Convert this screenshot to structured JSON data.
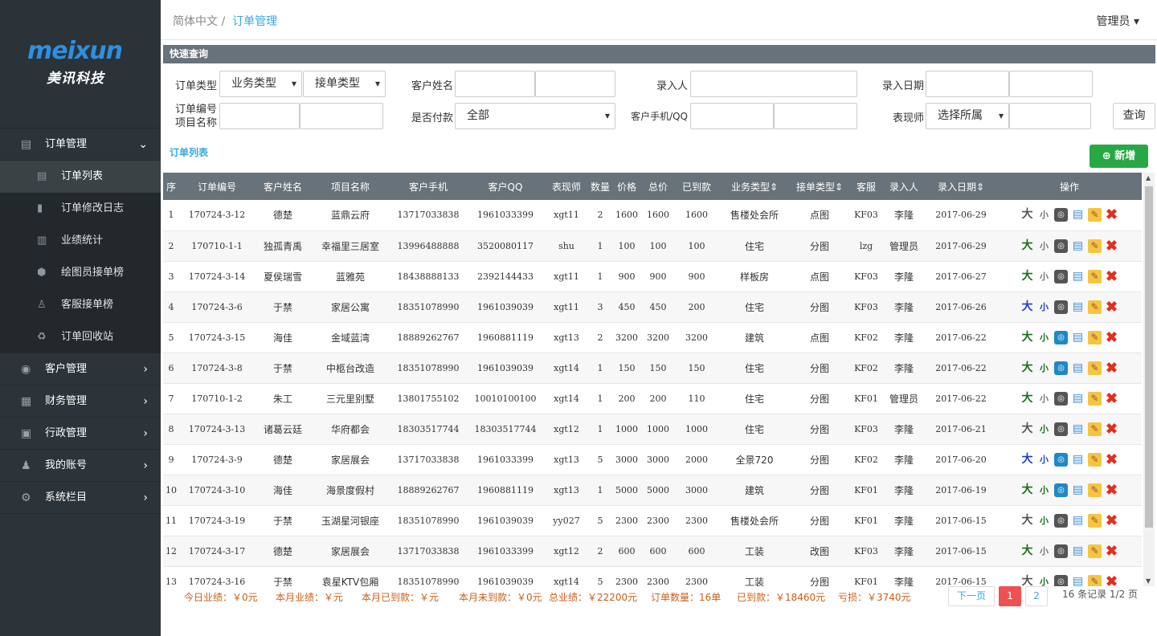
{
  "logo": {
    "word": "meixun",
    "cn": "美讯科技"
  },
  "menu": [
    {
      "label": "订单管理",
      "icon": "▤",
      "arrow": "⌄",
      "open": true,
      "children": [
        {
          "label": "订单列表",
          "icon": "▤",
          "active": true
        },
        {
          "label": "订单修改日志",
          "icon": "▮"
        },
        {
          "label": "业绩统计",
          "icon": "▥"
        },
        {
          "label": "绘图员接单榜",
          "icon": "⬢"
        },
        {
          "label": "客服接单榜",
          "icon": "♙"
        },
        {
          "label": "订单回收站",
          "icon": "♻"
        }
      ]
    },
    {
      "label": "客户管理",
      "icon": "◉",
      "arrow": "›"
    },
    {
      "label": "财务管理",
      "icon": "▦",
      "arrow": "›"
    },
    {
      "label": "行政管理",
      "icon": "▣",
      "arrow": "›"
    },
    {
      "label": "我的账号",
      "icon": "♟",
      "arrow": "›"
    },
    {
      "label": "系统栏目",
      "icon": "⚙",
      "arrow": "›"
    }
  ],
  "breadcrumb": {
    "root": "简体中文",
    "sep": "/",
    "current": "订单管理"
  },
  "user": {
    "name": "管理员",
    "caret": "▾"
  },
  "quick": {
    "title": "快速查询",
    "order_type": "订单类型",
    "biz_type": "业务类型",
    "take_type": "接单类型",
    "cust_name": "客户姓名",
    "entered_by": "录入人",
    "entry_date": "录入日期",
    "order_no": "订单编号",
    "project_name": "项目名称",
    "paid": "是否付款",
    "paid_value": "全部",
    "phone": "客户手机/QQ",
    "artist": "表现师",
    "artist_value": "选择所属",
    "query": "查询"
  },
  "list": {
    "title": "订单列表",
    "add": "新增",
    "add_icon": "⊕"
  },
  "table": {
    "headers": [
      "序",
      "订单编号",
      "客户姓名",
      "项目名称",
      "客户手机",
      "客户QQ",
      "表现师",
      "数量",
      "价格",
      "总价",
      "已到款",
      "业务类型⇕",
      "接单类型⇕",
      "客服",
      "录入人",
      "录入日期⇕",
      "操作"
    ],
    "rows": [
      [
        "1",
        "170724-3-12",
        "德楚",
        "蓝鼎云府",
        "13717033838",
        "1961033399",
        "xgt11",
        "2",
        "1600",
        "1600",
        "1600",
        "售楼处会所",
        "点图",
        "KF03",
        "李隆",
        "2017-06-29"
      ],
      [
        "2",
        "170710-1-1",
        "独孤青禹",
        "幸福里三居室",
        "13996488888",
        "3520080117",
        "shu",
        "1",
        "100",
        "100",
        "100",
        "住宅",
        "分图",
        "lzg",
        "管理员",
        "2017-06-29"
      ],
      [
        "3",
        "170724-3-14",
        "夏侯瑞雪",
        "蓝雅苑",
        "18438888133",
        "2392144433",
        "xgt11",
        "1",
        "900",
        "900",
        "900",
        "样板房",
        "点图",
        "KF03",
        "李隆",
        "2017-06-27"
      ],
      [
        "4",
        "170724-3-6",
        "于禁",
        "家居公寓",
        "18351078990",
        "1961039039",
        "xgt11",
        "3",
        "450",
        "450",
        "200",
        "住宅",
        "分图",
        "KF03",
        "李隆",
        "2017-06-26"
      ],
      [
        "5",
        "170724-3-15",
        "海佳",
        "金域蓝湾",
        "18889262767",
        "1960881119",
        "xgt13",
        "2",
        "3200",
        "3200",
        "3200",
        "建筑",
        "点图",
        "KF02",
        "李隆",
        "2017-06-22"
      ],
      [
        "6",
        "170724-3-8",
        "于禁",
        "中柩台改造",
        "18351078990",
        "1961039039",
        "xgt14",
        "1",
        "150",
        "150",
        "150",
        "住宅",
        "分图",
        "KF02",
        "李隆",
        "2017-06-22"
      ],
      [
        "7",
        "170710-1-2",
        "朱工",
        "三元里别墅",
        "13801755102",
        "10010100100",
        "xgt14",
        "1",
        "200",
        "200",
        "110",
        "住宅",
        "分图",
        "KF01",
        "管理员",
        "2017-06-22"
      ],
      [
        "8",
        "170724-3-13",
        "诸葛云廷",
        "华府都会",
        "18303517744",
        "18303517744",
        "xgt12",
        "1",
        "1000",
        "1000",
        "1000",
        "住宅",
        "分图",
        "KF03",
        "李隆",
        "2017-06-21"
      ],
      [
        "9",
        "170724-3-9",
        "德楚",
        "家居展会",
        "13717033838",
        "1961033399",
        "xgt13",
        "5",
        "3000",
        "3000",
        "2000",
        "全景720",
        "分图",
        "KF02",
        "李隆",
        "2017-06-20"
      ],
      [
        "10",
        "170724-3-10",
        "海佳",
        "海景度假村",
        "18889262767",
        "1960881119",
        "xgt13",
        "1",
        "5000",
        "5000",
        "3000",
        "建筑",
        "分图",
        "KF01",
        "李隆",
        "2017-06-19"
      ],
      [
        "11",
        "170724-3-19",
        "于禁",
        "玉湖星河银座",
        "18351078990",
        "1961039039",
        "yy027",
        "5",
        "2300",
        "2300",
        "2300",
        "售楼处会所",
        "分图",
        "KF01",
        "李隆",
        "2017-06-15"
      ],
      [
        "12",
        "170724-3-17",
        "德楚",
        "家居展会",
        "13717033838",
        "1961033399",
        "xgt12",
        "2",
        "600",
        "600",
        "600",
        "工装",
        "改图",
        "KF03",
        "李隆",
        "2017-06-15"
      ],
      [
        "13",
        "170724-3-16",
        "于禁",
        "袁星KTV包厢",
        "18351078990",
        "1961039039",
        "xgt14",
        "5",
        "2300",
        "2300",
        "2300",
        "工装",
        "分图",
        "KF01",
        "李隆",
        "2017-06-15"
      ]
    ],
    "op_states": [
      [
        "#555",
        "#777",
        false
      ],
      [
        "#1a6e1a",
        "#777",
        false
      ],
      [
        "#1a6e1a",
        "#777",
        false
      ],
      [
        "#1e3fd0",
        "#1e3fd0",
        false
      ],
      [
        "#1a6e1a",
        "#1a6e1a",
        true
      ],
      [
        "#1a6e1a",
        "#1a6e1a",
        true
      ],
      [
        "#1a6e1a",
        "#777",
        false
      ],
      [
        "#555",
        "#1a6e1a",
        false
      ],
      [
        "#1e3fd0",
        "#1e3fd0",
        true
      ],
      [
        "#1a6e1a",
        "#1a6e1a",
        true
      ],
      [
        "#555",
        "#1a6e1a",
        false
      ],
      [
        "#1a6e1a",
        "#777",
        false
      ],
      [
        "#555",
        "#1a6e1a",
        false
      ]
    ]
  },
  "icons": {
    "op1": "大",
    "op2": "小",
    "op3": "◎",
    "op4": "▤",
    "op5": "✎",
    "op6": "✖"
  },
  "footer": {
    "today": "今日业绩：￥0元",
    "month": "本月业绩：￥元",
    "month_paid": "本月已到款：￥元",
    "month_unpaid": "本月未到款：￥0元",
    "total": "总业绩：￥22200元",
    "count": "订单数量：16单",
    "paid": "已到款：￥18460元",
    "loss": "亏损：￥3740元"
  },
  "pagination": {
    "next": "下一页",
    "p1": "1",
    "p2": "2",
    "info": "16 条记录 1/2 页"
  }
}
